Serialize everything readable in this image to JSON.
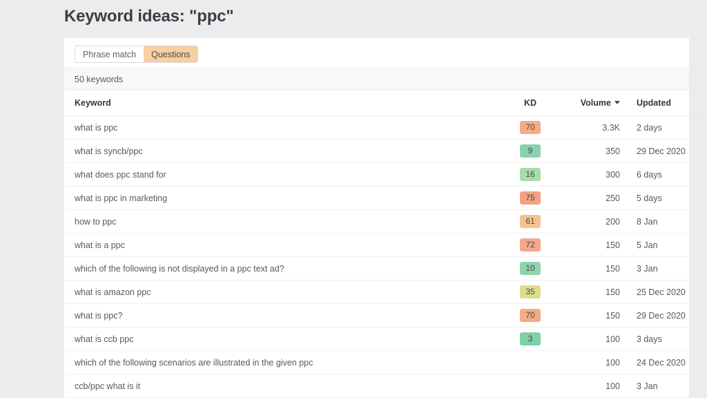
{
  "page": {
    "title": "Keyword ideas: \"ppc\"",
    "background_color": "#eaecee"
  },
  "tabs": [
    {
      "label": "Phrase match",
      "active": false
    },
    {
      "label": "Questions",
      "active": true
    }
  ],
  "summary": {
    "count_label": "50 keywords"
  },
  "table": {
    "columns": [
      {
        "key": "keyword",
        "label": "Keyword",
        "sorted": false
      },
      {
        "key": "kd",
        "label": "KD",
        "sorted": false
      },
      {
        "key": "volume",
        "label": "Volume",
        "sorted": true,
        "sort_icon": "triangle-down-icon",
        "sort_direction": "desc"
      },
      {
        "key": "updated",
        "label": "Updated",
        "sorted": false
      }
    ],
    "rows": [
      {
        "keyword": "what is ppc",
        "kd": "70",
        "kd_color": "#f4ab86",
        "volume": "3.3K",
        "updated": "2 days"
      },
      {
        "keyword": "what is syncb/ppc",
        "kd": "9",
        "kd_color": "#88d3ae",
        "volume": "350",
        "updated": "29 Dec 2020"
      },
      {
        "keyword": "what does ppc stand for",
        "kd": "16",
        "kd_color": "#a7dda8",
        "volume": "300",
        "updated": "6 days"
      },
      {
        "keyword": "what is ppc in marketing",
        "kd": "75",
        "kd_color": "#f4a183",
        "volume": "250",
        "updated": "5 days"
      },
      {
        "keyword": "how to ppc",
        "kd": "61",
        "kd_color": "#f6c18e",
        "volume": "200",
        "updated": "8 Jan"
      },
      {
        "keyword": "what is a ppc",
        "kd": "72",
        "kd_color": "#f4a88a",
        "volume": "150",
        "updated": "5 Jan"
      },
      {
        "keyword": "which of the following is not displayed in a ppc text ad?",
        "kd": "10",
        "kd_color": "#8ed4ae",
        "volume": "150",
        "updated": "3 Jan"
      },
      {
        "keyword": "what is amazon ppc",
        "kd": "35",
        "kd_color": "#ddde8c",
        "volume": "150",
        "updated": "25 Dec 2020"
      },
      {
        "keyword": "what is ppc?",
        "kd": "70",
        "kd_color": "#f4ab86",
        "volume": "150",
        "updated": "29 Dec 2020"
      },
      {
        "keyword": "what is ccb ppc",
        "kd": "3",
        "kd_color": "#7ed0a8",
        "volume": "100",
        "updated": "3 days"
      },
      {
        "keyword": "which of the following scenarios are illustrated in the given ppc",
        "kd": "",
        "kd_color": "",
        "volume": "100",
        "updated": "24 Dec 2020"
      },
      {
        "keyword": "ccb/ppc what is it",
        "kd": "",
        "kd_color": "",
        "volume": "100",
        "updated": "3 Jan"
      }
    ]
  }
}
